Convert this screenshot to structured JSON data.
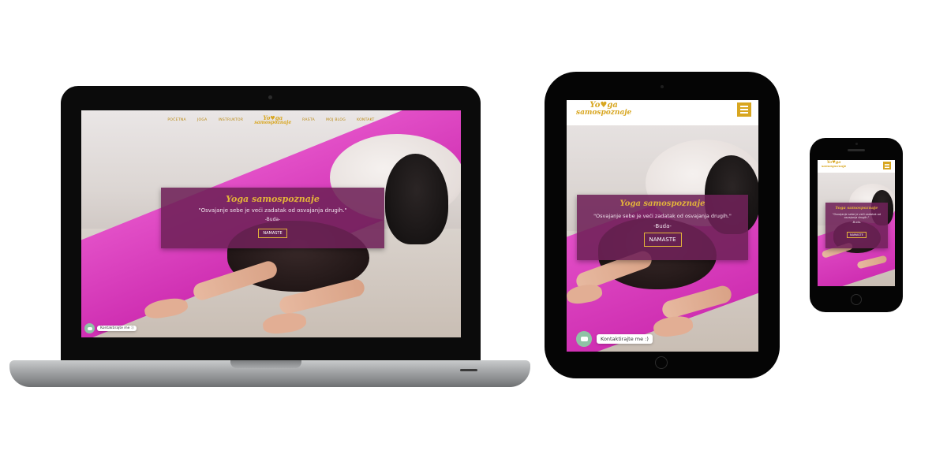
{
  "site": {
    "logo_top": "Yo",
    "logo_heart": "♥",
    "logo_top_end": "ga",
    "logo_bottom": "samospoznaje",
    "nav": [
      "POČETNA",
      "JOGA",
      "INSTRUKTOR",
      "RASTA",
      "MOJ BLOG",
      "KONTAKT"
    ],
    "hero": {
      "title": "Yoga samospoznaje",
      "quote": "\"Osvajanje sebe je veći zadatak od osvajanja drugih.\"",
      "author": "-Buda-",
      "button": "NAMASTE"
    },
    "chat_label": "Kontaktirajte me :)"
  },
  "colors": {
    "accent_gold": "#d8a620",
    "hero_purple": "#6e2158",
    "mat_pink": "#d83bb9",
    "chat_green": "#8fc3a5"
  },
  "icons": [
    "chat-icon",
    "hamburger-menu-icon",
    "heart-icon"
  ]
}
